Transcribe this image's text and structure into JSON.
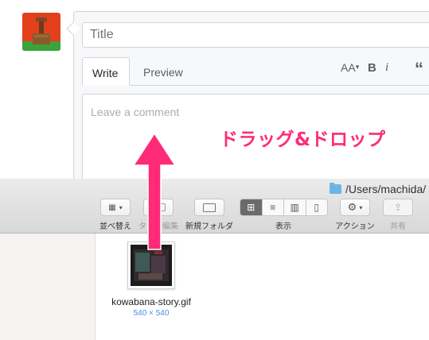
{
  "editor": {
    "title_placeholder": "Title",
    "tabs": [
      {
        "label": "Write",
        "active": true
      },
      {
        "label": "Preview",
        "active": false
      }
    ],
    "toolbar": {
      "text_size": "AA",
      "bold": "B",
      "italic": "i",
      "quote": "“"
    },
    "comment_placeholder": "Leave a comment"
  },
  "annotation": {
    "text": "ドラッグ&ドロップ",
    "color": "#ff2b78"
  },
  "finder": {
    "path": "/Users/machida/",
    "toolbar": {
      "arrange_label": "並べ替え",
      "edit_tags_label": "タグを編集",
      "new_folder_label": "新規フォルダ",
      "view_label": "表示",
      "action_label": "アクション",
      "share_label": "共有"
    },
    "file": {
      "name": "kowabana-story.gif",
      "dimensions": "540 × 540"
    }
  }
}
